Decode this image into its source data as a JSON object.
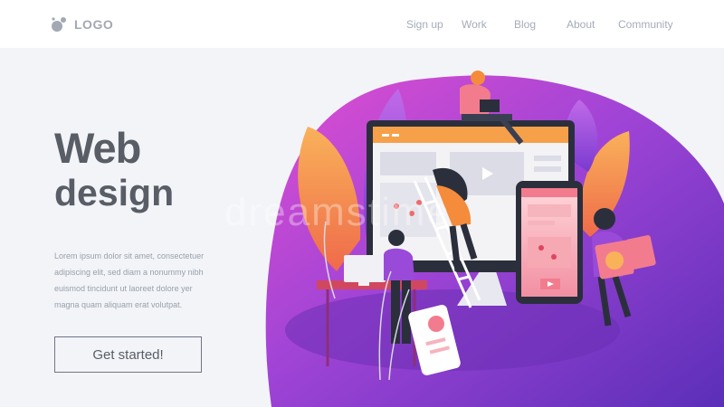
{
  "header": {
    "logo_text": "LOGO",
    "nav": [
      "Sign up",
      "Work",
      "Blog",
      "About",
      "Community"
    ]
  },
  "hero": {
    "title_line1": "Web",
    "title_line2": "design",
    "body": "Lorem ipsum dolor sit amet, consectetuer adipiscing elit, sed diam a nonummy nibh euismod tincidunt ut laoreet dolore yer magna quam aliquam erat volutpat.",
    "cta_label": "Get started!"
  },
  "watermark": "dreamstime",
  "colors": {
    "blob_purple": "#8a3fc9",
    "blob_pink": "#e14ed0",
    "orange": "#f48c3c",
    "text_dark": "#595d66"
  }
}
